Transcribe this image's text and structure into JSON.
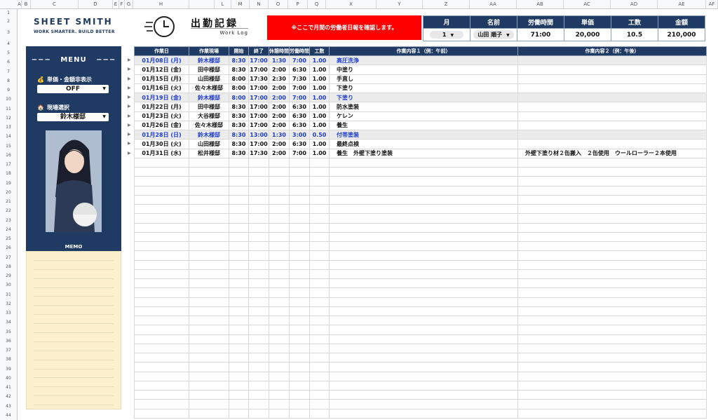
{
  "sheet": {
    "columns": [
      "A",
      "B",
      "C",
      "D",
      "E",
      "F",
      "G",
      "H",
      "",
      "L",
      "M",
      "N",
      "O",
      "P",
      "Q",
      "X",
      "Y",
      "Z",
      "AA",
      "AB",
      "AC",
      "AD",
      "AE",
      "AF"
    ],
    "rows": [
      "1",
      "2",
      "3",
      "4",
      "5",
      "6",
      "7",
      "8",
      "9",
      "10",
      "11",
      "12",
      "13",
      "14",
      "15",
      "16",
      "17",
      "18",
      "19",
      "20",
      "21",
      "22",
      "23",
      "24",
      "25",
      "26",
      "27",
      "28",
      "29",
      "30",
      "31",
      "32",
      "33",
      "34",
      "35",
      "36",
      "37",
      "38",
      "39",
      "40",
      "41",
      "42",
      "43",
      "44"
    ]
  },
  "logo": {
    "main": "SHEET SMITH",
    "sub": "WORK SMARTER.  BUILD BETTER"
  },
  "title": {
    "main": "出勤記録",
    "sub": "Work Log"
  },
  "notice": "※ここで月間の労働者日報を確認します。",
  "summary": {
    "headers": [
      "月",
      "名前",
      "労働時間",
      "単価",
      "工数",
      "金額"
    ],
    "month": "1",
    "name": "山田 順子",
    "hours": "71:00",
    "unit_price": "20,000",
    "man_days": "10.5",
    "amount": "210,000"
  },
  "menu": {
    "title": "MENU",
    "hide_label": "単価・金額非表示",
    "hide_value": "OFF",
    "site_label": "現場選択",
    "site_value": "鈴木様邸",
    "memo_title": "MEMO",
    "icons": {
      "hide": "money-bag-icon",
      "site": "house-icon"
    }
  },
  "table": {
    "headers": [
      "作業日",
      "作業現場",
      "開始",
      "終了",
      "休憩時間",
      "労働時間",
      "工数",
      "作業内容１（例：午前）",
      "作業内容２（例：午後）"
    ],
    "rows": [
      {
        "date": "01月08日 (月)",
        "site": "鈴木様邸",
        "start": "8:30",
        "end": "17:00",
        "break": "1:30",
        "work": "7:00",
        "md": "1.00",
        "am": "高圧洗浄",
        "pm": "",
        "hl": true
      },
      {
        "date": "01月12日 (金)",
        "site": "田中様邸",
        "start": "8:30",
        "end": "17:00",
        "break": "2:00",
        "work": "6:30",
        "md": "1.00",
        "am": "中塗り",
        "pm": "",
        "hl": false
      },
      {
        "date": "01月15日 (月)",
        "site": "山田様邸",
        "start": "8:00",
        "end": "17:30",
        "break": "2:30",
        "work": "7:30",
        "md": "1.00",
        "am": "手直し",
        "pm": "",
        "hl": false
      },
      {
        "date": "01月16日 (火)",
        "site": "佐々木様邸",
        "start": "8:00",
        "end": "17:00",
        "break": "2:00",
        "work": "7:00",
        "md": "1.00",
        "am": "下塗り",
        "pm": "",
        "hl": false
      },
      {
        "date": "01月19日 (金)",
        "site": "鈴木様邸",
        "start": "8:00",
        "end": "17:00",
        "break": "2:00",
        "work": "7:00",
        "md": "1.00",
        "am": "下塗り",
        "pm": "",
        "hl": true
      },
      {
        "date": "01月22日 (月)",
        "site": "田中様邸",
        "start": "8:30",
        "end": "17:00",
        "break": "2:00",
        "work": "6:30",
        "md": "1.00",
        "am": "防水塗装",
        "pm": "",
        "hl": false
      },
      {
        "date": "01月23日 (火)",
        "site": "大谷様邸",
        "start": "8:30",
        "end": "17:00",
        "break": "2:00",
        "work": "6:30",
        "md": "1.00",
        "am": "ケレン",
        "pm": "",
        "hl": false
      },
      {
        "date": "01月26日 (金)",
        "site": "佐々木様邸",
        "start": "8:30",
        "end": "17:00",
        "break": "2:00",
        "work": "6:30",
        "md": "1.00",
        "am": "養生",
        "pm": "",
        "hl": false
      },
      {
        "date": "01月28日 (日)",
        "site": "鈴木様邸",
        "start": "8:30",
        "end": "13:00",
        "break": "1:30",
        "work": "3:00",
        "md": "0.50",
        "am": "付帯塗装",
        "pm": "",
        "hl": true
      },
      {
        "date": "01月30日 (火)",
        "site": "山田様邸",
        "start": "8:30",
        "end": "17:00",
        "break": "2:00",
        "work": "6:30",
        "md": "1.00",
        "am": "最終点検",
        "pm": "",
        "hl": false
      },
      {
        "date": "01月31日 (水)",
        "site": "松井様邸",
        "start": "8:30",
        "end": "17:30",
        "break": "2:00",
        "work": "7:00",
        "md": "1.00",
        "am": "養生　外壁下塗り塗装",
        "pm": "外壁下塗り材２缶搬入　２缶使用　ウールローラー２本使用",
        "hl": false
      }
    ],
    "empty_rows": 28
  }
}
